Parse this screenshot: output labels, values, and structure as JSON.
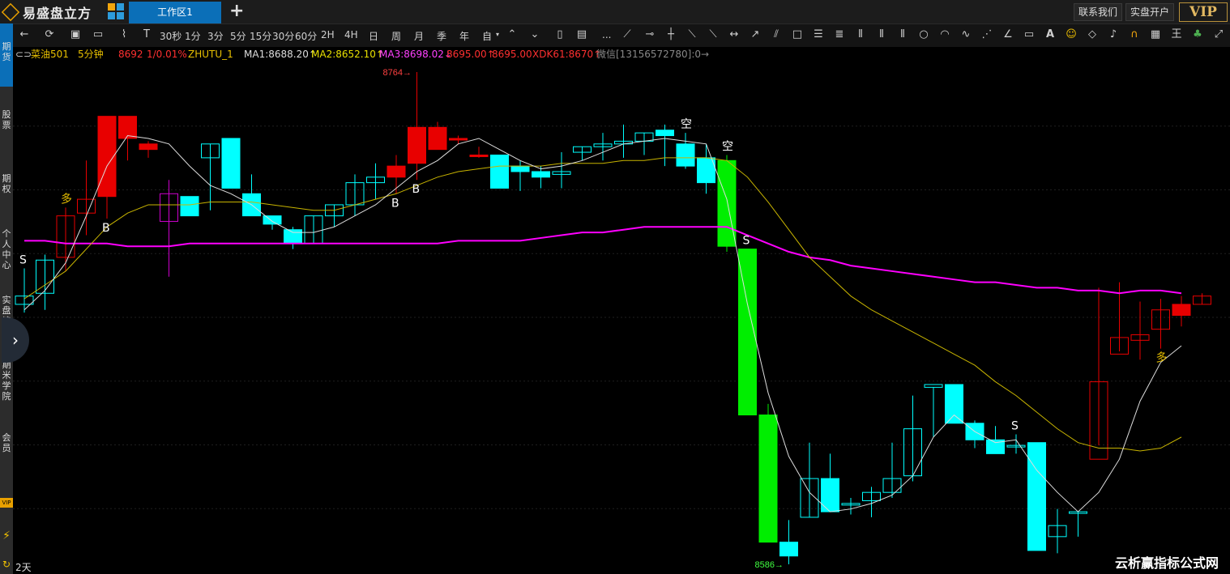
{
  "app": {
    "logo_text": "易盛盘立方",
    "workspace_tab": "工作区1",
    "add_tab": "+",
    "buttons": {
      "contact": "联系我们",
      "open_account": "实盘开户",
      "vip": "VIP"
    }
  },
  "toolbar": {
    "periods": [
      "30秒",
      "1分",
      "3分",
      "5分",
      "15分",
      "30分",
      "60分",
      "2H",
      "4H",
      "日",
      "周",
      "月",
      "季",
      "年",
      "自"
    ],
    "more": "..."
  },
  "sidebar": {
    "items": [
      "期货",
      "股票",
      "期权",
      "个人中心",
      "实盘榜单",
      "期米学院",
      "会员"
    ],
    "vip_badge": "VIP"
  },
  "info": {
    "symbol": "菜油501",
    "period": "5分钟",
    "last": "8692",
    "change": "1/0.01%",
    "indicator": "ZHUTU_1",
    "ma1": "MA1:8688.20↑",
    "ma2": "MA2:8652.10↑",
    "ma3": "MA3:8698.02↓",
    "v1": "8695.00↑",
    "v2": "8695.00",
    "xdk": "XDK61:8670↑",
    "wechat": "微信[13156572780]:0→"
  },
  "colors": {
    "up": "#e80000",
    "down": "#00ffff",
    "green": "#00ee00",
    "ma1": "#dddddd",
    "ma2": "#c8b400",
    "ma3": "#ff00ff",
    "magenta": "#cc00cc"
  },
  "footer": {
    "range": "2天"
  },
  "watermark": "云析赢指标公式网",
  "chart_data": {
    "type": "candlestick",
    "symbol": "菜油501",
    "period": "5分钟",
    "y_range": [
      8586,
      8764
    ],
    "annotations": {
      "high_label": "8764",
      "low_label": "8586"
    },
    "ohlc": [
      [
        8680,
        8693,
        8677,
        8683,
        "down"
      ],
      [
        8684,
        8698,
        8678,
        8696,
        "down"
      ],
      [
        8697,
        8715,
        8692,
        8712,
        "up"
      ],
      [
        8713,
        8732,
        8705,
        8718,
        "up"
      ],
      [
        8719,
        8748,
        8711,
        8748,
        "up"
      ],
      [
        8748,
        8748,
        8732,
        8740,
        "up"
      ],
      [
        8738,
        8739,
        8733,
        8736,
        "up"
      ],
      [
        8710,
        8725,
        8690,
        8720,
        "magenta"
      ],
      [
        8719,
        8719,
        8712,
        8712,
        "down"
      ],
      [
        8733,
        8738,
        8714,
        8738,
        "down"
      ],
      [
        8740,
        8740,
        8722,
        8722,
        "down"
      ],
      [
        8720,
        8727,
        8712,
        8712,
        "down"
      ],
      [
        8712,
        8712,
        8707,
        8709,
        "down"
      ],
      [
        8707,
        8708,
        8700,
        8702,
        "down"
      ],
      [
        8702,
        8712,
        8702,
        8712,
        "down"
      ],
      [
        8712,
        8716,
        8708,
        8716,
        "down"
      ],
      [
        8716,
        8727,
        8712,
        8724,
        "down"
      ],
      [
        8724,
        8731,
        8718,
        8726,
        "down"
      ],
      [
        8726,
        8734,
        8720,
        8730,
        "up"
      ],
      [
        8731,
        8764,
        8725,
        8744,
        "up"
      ],
      [
        8744,
        8746,
        8736,
        8736,
        "up"
      ],
      [
        8740,
        8741,
        8738,
        8740,
        "up"
      ],
      [
        8734,
        8737,
        8733,
        8734,
        "up"
      ],
      [
        8734,
        8734,
        8722,
        8722,
        "down"
      ],
      [
        8730,
        8732,
        8721,
        8728,
        "down"
      ],
      [
        8728,
        8730,
        8722,
        8726,
        "down"
      ],
      [
        8727,
        8735,
        8722,
        8728,
        "down"
      ],
      [
        8735,
        8737,
        8732,
        8737,
        "down"
      ],
      [
        8737,
        8742,
        8732,
        8738,
        "down"
      ],
      [
        8738,
        8745,
        8733,
        8739,
        "down"
      ],
      [
        8739,
        8742,
        8734,
        8742,
        "down"
      ],
      [
        8743,
        8745,
        8730,
        8741,
        "down"
      ],
      [
        8738,
        8742,
        8729,
        8730,
        "down"
      ],
      [
        8733,
        8738,
        8720,
        8724,
        "down"
      ],
      [
        8732,
        8734,
        8699,
        8701,
        "green"
      ],
      [
        8700,
        8700,
        8640,
        8640,
        "green"
      ],
      [
        8640,
        8644,
        8594,
        8594,
        "green"
      ],
      [
        8594,
        8602,
        8586,
        8589,
        "down"
      ],
      [
        8603,
        8630,
        8603,
        8617,
        "down"
      ],
      [
        8617,
        8626,
        8611,
        8605,
        "down"
      ],
      [
        8608,
        8610,
        8604,
        8608,
        "down"
      ],
      [
        8609,
        8614,
        8603,
        8612,
        "down"
      ],
      [
        8612,
        8630,
        8610,
        8617,
        "down"
      ],
      [
        8618,
        8647,
        8616,
        8635,
        "down"
      ],
      [
        8650,
        8650,
        8632,
        8651,
        "down"
      ],
      [
        8651,
        8651,
        8637,
        8637,
        "down"
      ],
      [
        8637,
        8638,
        8628,
        8631,
        "down"
      ],
      [
        8631,
        8636,
        8626,
        8626,
        "down"
      ],
      [
        8629,
        8633,
        8626,
        8629,
        "down"
      ],
      [
        8630,
        8630,
        8591,
        8591,
        "down"
      ],
      [
        8596,
        8606,
        8590,
        8600,
        "down"
      ],
      [
        8605,
        8605,
        8596,
        8605,
        "down"
      ],
      [
        8624,
        8686,
        8629,
        8652,
        "up"
      ],
      [
        8668,
        8688,
        8663,
        8662,
        "up"
      ],
      [
        8669,
        8681,
        8660,
        8667,
        "up"
      ],
      [
        8678,
        8682,
        8664,
        8671,
        "up"
      ],
      [
        8680,
        8683,
        8672,
        8676,
        "up"
      ],
      [
        8683,
        8684,
        8680,
        8680,
        "up"
      ]
    ],
    "ma1": [
      8678,
      8685,
      8695,
      8712,
      8730,
      8741,
      8740,
      8738,
      8730,
      8723,
      8720,
      8716,
      8710,
      8706,
      8706,
      8708,
      8712,
      8716,
      8722,
      8728,
      8732,
      8738,
      8740,
      8736,
      8732,
      8729,
      8730,
      8732,
      8735,
      8738,
      8739,
      8740,
      8739,
      8738,
      8718,
      8680,
      8648,
      8625,
      8612,
      8605,
      8606,
      8608,
      8611,
      8618,
      8632,
      8640,
      8634,
      8630,
      8631,
      8620,
      8612,
      8605,
      8612,
      8624,
      8645,
      8659,
      8665
    ],
    "ma2": [
      8682,
      8687,
      8692,
      8700,
      8708,
      8713,
      8716,
      8716,
      8716,
      8717,
      8717,
      8717,
      8716,
      8715,
      8714,
      8714,
      8716,
      8718,
      8720,
      8723,
      8726,
      8728,
      8729,
      8730,
      8730,
      8730,
      8731,
      8731,
      8731,
      8732,
      8732,
      8733,
      8733,
      8733,
      8732,
      8726,
      8717,
      8707,
      8697,
      8690,
      8683,
      8678,
      8674,
      8670,
      8666,
      8662,
      8658,
      8652,
      8647,
      8641,
      8635,
      8630,
      8628,
      8628,
      8627,
      8628,
      8632
    ],
    "ma3": [
      8703,
      8703,
      8702,
      8702,
      8702,
      8701,
      8701,
      8701,
      8702,
      8702,
      8702,
      8702,
      8702,
      8702,
      8702,
      8702,
      8702,
      8702,
      8702,
      8702,
      8702,
      8703,
      8703,
      8703,
      8703,
      8704,
      8705,
      8706,
      8706,
      8707,
      8708,
      8708,
      8708,
      8708,
      8708,
      8705,
      8702,
      8699,
      8697,
      8696,
      8694,
      8693,
      8692,
      8691,
      8690,
      8689,
      8688,
      8688,
      8687,
      8686,
      8686,
      8685,
      8685,
      8684,
      8685,
      8685,
      8684
    ],
    "signals": [
      {
        "index": 0,
        "text": "S",
        "color": "#ffffff",
        "pos": "above"
      },
      {
        "index": 2,
        "text": "多",
        "color": "#e8c000",
        "pos": "above"
      },
      {
        "index": 4,
        "text": "B",
        "color": "#ffffff",
        "pos": "below"
      },
      {
        "index": 18,
        "text": "B",
        "color": "#ffffff",
        "pos": "below"
      },
      {
        "index": 19,
        "text": "B",
        "color": "#ffffff",
        "pos": "below"
      },
      {
        "index": 32,
        "text": "空",
        "color": "#ffffff",
        "pos": "above"
      },
      {
        "index": 34,
        "text": "空",
        "color": "#ffffff",
        "pos": "above"
      },
      {
        "index": 35,
        "text": "S",
        "color": "#ffffff",
        "pos": "above"
      },
      {
        "index": 48,
        "text": "S",
        "color": "#ffffff",
        "pos": "above"
      },
      {
        "index": 55,
        "text": "多",
        "color": "#e8c000",
        "pos": "below"
      }
    ]
  }
}
